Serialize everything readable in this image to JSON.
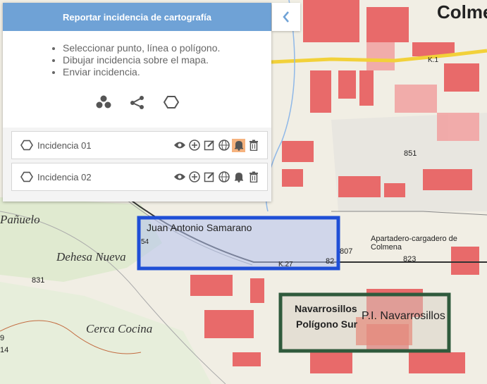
{
  "panel": {
    "title": "Reportar incidencia de cartografía",
    "instructions": [
      "Seleccionar punto, línea o polígono.",
      "Dibujar incidencia sobre el mapa.",
      "Enviar incidencia."
    ],
    "tools": [
      "points-icon",
      "line-icon",
      "polygon-icon"
    ]
  },
  "incidents": [
    {
      "label": "Incidencia 01",
      "notify_active": true
    },
    {
      "label": "Incidencia 02",
      "notify_active": false
    }
  ],
  "map": {
    "labels": {
      "town": "Colme",
      "panuelo": "Pañuelo",
      "dehesa": "Dehesa Nueva",
      "cerca": "Cerca Cocina",
      "juan": "Juan Antonio Samarano",
      "apartadero": "Apartadero-cargadero de Colmena",
      "navarrosillos": "Navarrosillos",
      "poligono": "Polígono Sur",
      "pi": "P.I. Navarrosillos",
      "n831": "831",
      "n851": "851",
      "n807": "807",
      "n823": "823",
      "n82": "82",
      "k27": "K.27",
      "n54": "54",
      "n14": "14",
      "n9": "9",
      "k1": "K.1"
    },
    "colors": {
      "blue_outline": "#1f4fd6",
      "green_outline": "#2f5a3c",
      "road": "#f2d13a"
    }
  }
}
